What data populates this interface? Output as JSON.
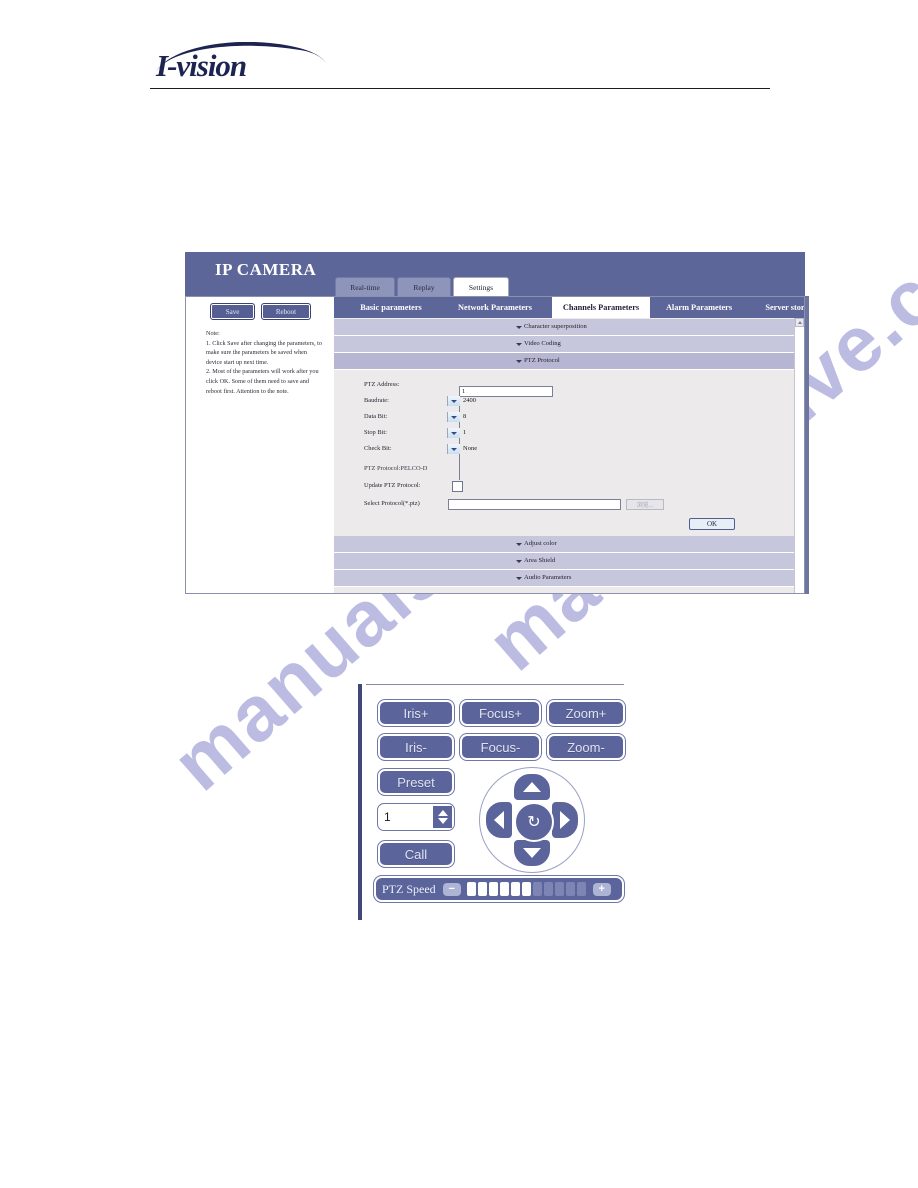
{
  "brand": {
    "logo_text": "I-vision"
  },
  "ipcam": {
    "title": "IP CAMERA",
    "top_tabs": [
      {
        "label": "Real-time",
        "active": false
      },
      {
        "label": "Replay",
        "active": false
      },
      {
        "label": "Settings",
        "active": true
      }
    ],
    "sidebar": {
      "save_label": "Save",
      "reboot_label": "Reboot",
      "note_title": "Note:",
      "note_1": "1. Click Save after changing the parameters, to make sure the parameters be saved when device start up next time.",
      "note_2": "2. Most of the parameters will work after you click OK. Some of them need to save and reboot first. Attention to the note."
    },
    "nav_tabs": [
      {
        "label": "Basic parameters",
        "active": false
      },
      {
        "label": "Network Parameters",
        "active": false
      },
      {
        "label": "Channels Parameters",
        "active": true
      },
      {
        "label": "Alarm Parameters",
        "active": false
      },
      {
        "label": "Server storage",
        "active": false
      }
    ],
    "accordion": [
      {
        "label": "Character superposition"
      },
      {
        "label": "Video Coding"
      },
      {
        "label": "PTZ Protocol"
      },
      {
        "label": "Adjust color"
      },
      {
        "label": "Area Shield"
      },
      {
        "label": "Audio Parameters"
      }
    ],
    "form": {
      "ptz_address_label": "PTZ Address:",
      "ptz_address_value": "1",
      "baudrate_label": "Baudrate:",
      "baudrate_value": "2400",
      "data_bit_label": "Data Bit:",
      "data_bit_value": "8",
      "stop_bit_label": "Stop Bit:",
      "stop_bit_value": "1",
      "check_bit_label": "Check Bit:",
      "check_bit_value": "None",
      "protocol_line": "PTZ Protocol:PELCO-D",
      "update_label": "Update PTZ Protocol:",
      "select_label": "Select Protocol(*.ptz)",
      "select_value": "",
      "browse_label": "浏览...",
      "ok_label": "OK"
    }
  },
  "ptz_control": {
    "buttons": [
      {
        "label": "Iris+"
      },
      {
        "label": "Focus+"
      },
      {
        "label": "Zoom+"
      },
      {
        "label": "Iris-"
      },
      {
        "label": "Focus-"
      },
      {
        "label": "Zoom-"
      },
      {
        "label": "Preset"
      },
      {
        "label": "Call"
      }
    ],
    "preset_value": "1",
    "center_icon": "↻",
    "speed": {
      "label": "PTZ Speed",
      "minus": "−",
      "plus": "+",
      "segments_total": 11,
      "segments_filled": 6
    }
  },
  "watermark": {
    "line1": "manualshive.com",
    "line2": "manualshive.com",
    "color": "#b9b9e2"
  },
  "colors": {
    "header_band": "#5d6699",
    "accordion_row": "#c6c6dc",
    "panel_body": "#eceaea",
    "button_fill": "#5c659b",
    "logo": "#1d2452"
  }
}
